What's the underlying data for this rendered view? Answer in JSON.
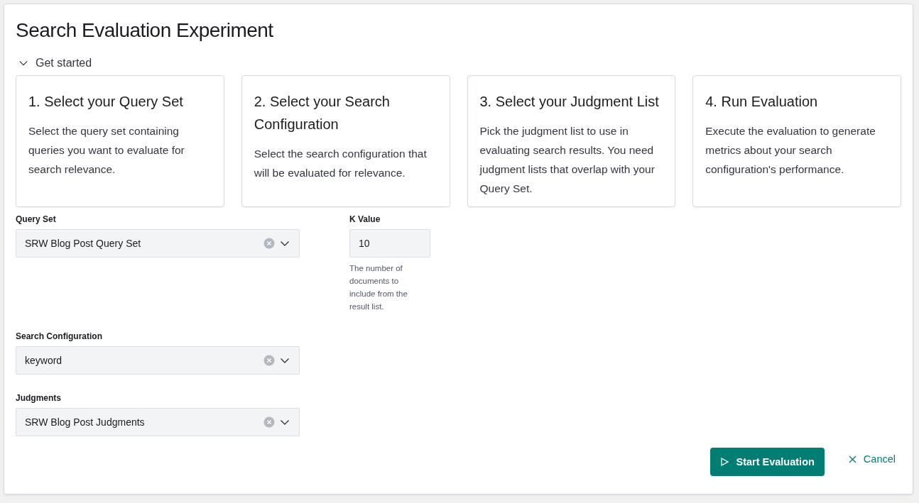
{
  "title": "Search Evaluation Experiment",
  "get_started": {
    "label": "Get started",
    "expanded": true
  },
  "steps": [
    {
      "title": "1. Select your Query Set",
      "description": "Select the query set containing queries you want to evaluate for search relevance."
    },
    {
      "title": "2. Select your Search Configuration",
      "description": "Select the search configuration that will be evaluated for relevance."
    },
    {
      "title": "3. Select your Judgment List",
      "description": "Pick the judgment list to use in evaluating search results. You need judgment lists that overlap with your Query Set."
    },
    {
      "title": "4. Run Evaluation",
      "description": "Execute the evaluation to generate metrics about your search configuration's performance."
    }
  ],
  "fields": [
    {
      "kind": "combo",
      "label": "Query Set",
      "value": "SRW Blog Post Query Set"
    },
    {
      "kind": "number",
      "label": "K Value",
      "value": "10",
      "help": "The number of documents to include from the result list."
    },
    {
      "kind": "combo",
      "label": "Search Configuration",
      "value": "keyword"
    },
    {
      "kind": "combo",
      "label": "Judgments",
      "value": "SRW Blog Post Judgments"
    }
  ],
  "actions": {
    "primary": "Start Evaluation",
    "cancel": "Cancel"
  }
}
